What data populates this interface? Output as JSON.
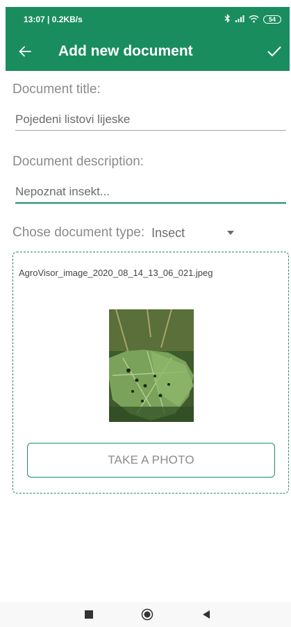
{
  "status_bar": {
    "time_speed": "13:07 | 0.2KB/s",
    "battery": "54",
    "icons": [
      "bluetooth-icon",
      "signal-icon",
      "wifi-icon",
      "battery-icon"
    ]
  },
  "app_bar": {
    "title": "Add new document",
    "back_icon": "arrow-left-icon",
    "confirm_icon": "check-icon"
  },
  "form": {
    "title_label": "Document title:",
    "title_value": "Pojedeni listovi lijeske",
    "description_label": "Document description:",
    "description_value": "Nepoznat insekt...",
    "type_label": "Chose document type:",
    "type_value": "Insect"
  },
  "attachment": {
    "file_name": "AgroVisor_image_2020_08_14_13_06_021.jpeg",
    "take_photo_label": "TAKE A PHOTO"
  },
  "nav_bar": {
    "icons": [
      "recents-icon",
      "home-icon",
      "back-triangle-icon"
    ]
  },
  "colors": {
    "primary": "#1a8d5f",
    "text_secondary": "#8a8a8a",
    "background": "#ffffff"
  }
}
